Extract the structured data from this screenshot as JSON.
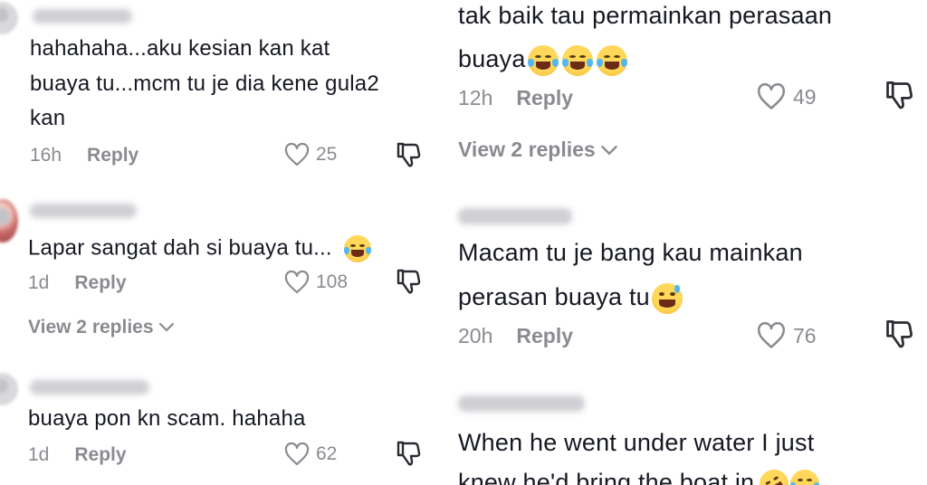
{
  "left_column": {
    "comments": [
      {
        "text_lines": [
          "hahahaha...aku kesian kan kat",
          "buaya tu...mcm tu je dia kene gula2",
          "kan"
        ],
        "time": "16h",
        "reply_label": "Reply",
        "likes": "25"
      },
      {
        "text_lines": [
          "Lapar sangat dah si buaya tu..."
        ],
        "emoji": "face-with-tears-of-joy",
        "time": "1d",
        "reply_label": "Reply",
        "likes": "108",
        "view_replies": "View 2 replies"
      },
      {
        "text_lines": [
          "buaya pon kn scam. hahaha"
        ],
        "time": "1d",
        "reply_label": "Reply",
        "likes": "62"
      }
    ]
  },
  "right_column": {
    "comments": [
      {
        "text_lines": [
          "tak baik tau permainkan perasaan",
          "buaya"
        ],
        "emoji": "face-with-tears-of-joy x3",
        "time": "12h",
        "reply_label": "Reply",
        "likes": "49",
        "view_replies": "View 2 replies"
      },
      {
        "text_lines": [
          "Macam tu je bang kau mainkan",
          "perasan buaya tu"
        ],
        "emoji": "grinning-face-with-sweat",
        "time": "20h",
        "reply_label": "Reply",
        "likes": "76"
      },
      {
        "text_lines": [
          "When he went under water I just",
          "knew he'd bring the boat in"
        ],
        "emoji": "rolling-on-floor-laughing, face-with-tears-of-joy"
      }
    ]
  },
  "icons": {
    "like": "heart-outline-icon",
    "dislike": "thumbs-down-icon",
    "chevron": "chevron-down-icon"
  },
  "colors": {
    "text": "#161823",
    "meta": "#8a8b91",
    "background": "#ffffff"
  }
}
